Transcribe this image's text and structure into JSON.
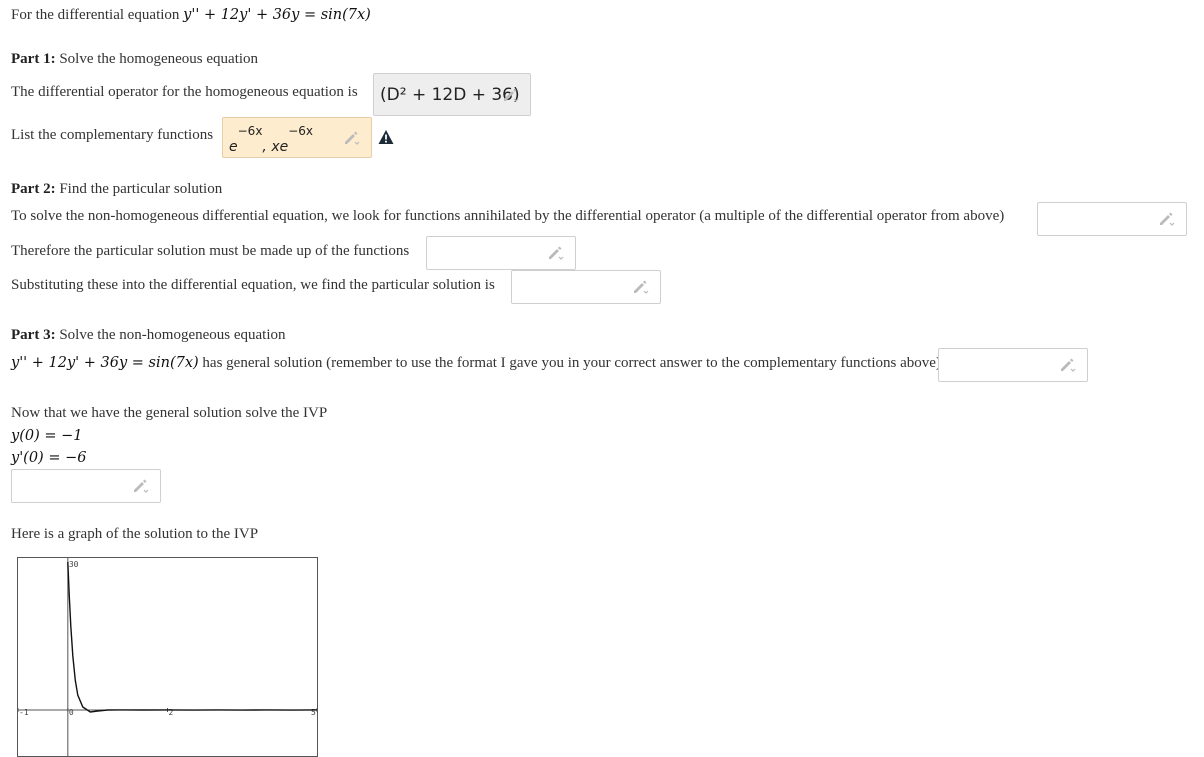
{
  "intro": {
    "prefix": "For the differential equation",
    "equation": "y'' + 12y' + 36y = sin(7x)"
  },
  "part1": {
    "heading": "Part 1:",
    "title": "Solve the homogeneous equation",
    "operator_prompt": "The differential operator for the homogeneous equation is",
    "operator_answer": "(D² + 12D + 36)",
    "complementary_prompt": "List the complementary functions",
    "complementary_answer_part1": "e",
    "complementary_answer_exp1": "−6x",
    "complementary_answer_part2": ", xe",
    "complementary_answer_exp2": "−6x"
  },
  "part2": {
    "heading": "Part 2:",
    "title": "Find the particular solution",
    "annihilator_prompt": "To solve the non-homogeneous differential equation, we look for functions annihilated by the differential operator (a multiple of the differential operator from above)",
    "functions_prompt": "Therefore the particular solution must be made up of the functions",
    "particular_prompt": "Substituting these into the differential equation, we find the particular solution is"
  },
  "part3": {
    "heading": "Part 3:",
    "title": "Solve the non-homogeneous equation",
    "equation": "y'' + 12y' + 36y = sin(7x)",
    "general_prompt": "has general solution (remember to use the format I gave you in your correct answer to the complementary functions above)"
  },
  "ivp": {
    "prompt": "Now that we have the general solution solve the IVP",
    "cond1": "y(0) = −1",
    "cond2": "y'(0) = −6"
  },
  "graph": {
    "caption": "Here is a graph of the solution to the IVP"
  },
  "chart_data": {
    "type": "line",
    "x_ticks": [
      "-1",
      "0",
      "2",
      "5"
    ],
    "y_ticks": [
      "30"
    ],
    "xlim": [
      -1,
      5
    ],
    "ylim": [
      -10,
      30
    ],
    "series": [
      {
        "x": [
          0,
          0.03,
          0.06,
          0.1,
          0.15,
          0.2,
          0.3,
          0.45,
          0.6,
          0.8,
          1.0,
          1.5,
          2,
          2.5,
          3,
          3.5,
          4,
          4.5,
          5
        ],
        "y": [
          30,
          23,
          17,
          11,
          6,
          3,
          0.6,
          -0.4,
          -0.2,
          0,
          0.02,
          0,
          0.02,
          -0.02,
          0.02,
          -0.02,
          0.02,
          -0.02,
          0.02
        ]
      }
    ],
    "colors": {
      "line": "#111111",
      "axis": "#555555"
    }
  }
}
